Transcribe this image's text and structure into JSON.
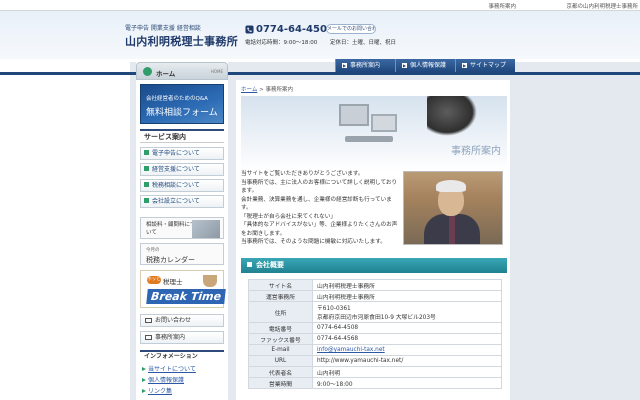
{
  "topbar": {
    "links": [
      "事務所案内",
      "京都の山内利明税理士事務所"
    ]
  },
  "header": {
    "subtitle": "電子申告 開業支援 経営相談",
    "office_name": "山内利明税理士事務所",
    "tel": "0774-64-4508",
    "hours": "電話対応時間：9:00～18:00",
    "mail_button": "メールでのお問い合わせは",
    "holidays": "定休日：土曜、日曜、祝日"
  },
  "nav": {
    "items": [
      "事務所案内",
      "個人情報保護",
      "サイトマップ"
    ]
  },
  "sidebar": {
    "home_label": "ホーム",
    "home_sub": "HOME",
    "banner_small": "会社経営者のためのQ&A",
    "banner_big": "無料相談フォーム",
    "services_title": "サービス案内",
    "services": [
      "電子申告について",
      "経営支援について",
      "税務相談について",
      "会社設立について"
    ],
    "fees_text": "相談料・顧問料について",
    "calendar_small": "今月の",
    "calendar_big": "税務カレンダー",
    "break_hot": "ホッと",
    "break_label": "税理士",
    "break_big": "Break Time",
    "link_contact": "お問い合わせ",
    "link_office": "事務所案内",
    "info_title": "インフォメーション",
    "info_links": [
      "当サイトについて",
      "個人情報保護",
      "リンク集"
    ]
  },
  "content": {
    "breadcrumb_home": "ホーム",
    "breadcrumb_sep": " > ",
    "breadcrumb_current": "事務所案内",
    "hero_title": "事務所案内",
    "intro": [
      "当サイトをご覧いただきありがとうございます。",
      "当事務所では、主に法人のお客様について詳しく説明しております。",
      "会計業務、決算業務を通し、企業様の経営診断も行っています。",
      "「税理士が自ら会社に来てくれない」",
      "「具体的なアドバイスがない」等、企業様よりたくさんのお声をお聞きします。",
      "当事務所では、そのような問題に機敏に対応いたします。"
    ],
    "section_title": "会社概要",
    "table": [
      {
        "k": "サイト名",
        "v": "山内利明税理士事務所"
      },
      {
        "k": "運営事務所",
        "v": "山内利明税理士事務所"
      },
      {
        "k": "住所",
        "v": "〒610-0361",
        "v2": "京都府京田辺市河原食田10-9 大塚ビル203号"
      },
      {
        "k": "電話番号",
        "v": "0774-64-4508"
      },
      {
        "k": "ファックス番号",
        "v": "0774-64-4568"
      },
      {
        "k": "E-mail",
        "v": "info@yamauchi-tax.net"
      },
      {
        "k": "URL",
        "v": "http://www.yamauchi-tax.net/"
      },
      {
        "k": "代表者名",
        "v": "山内利明"
      },
      {
        "k": "営業時間",
        "v": "9:00～18:00"
      }
    ]
  }
}
